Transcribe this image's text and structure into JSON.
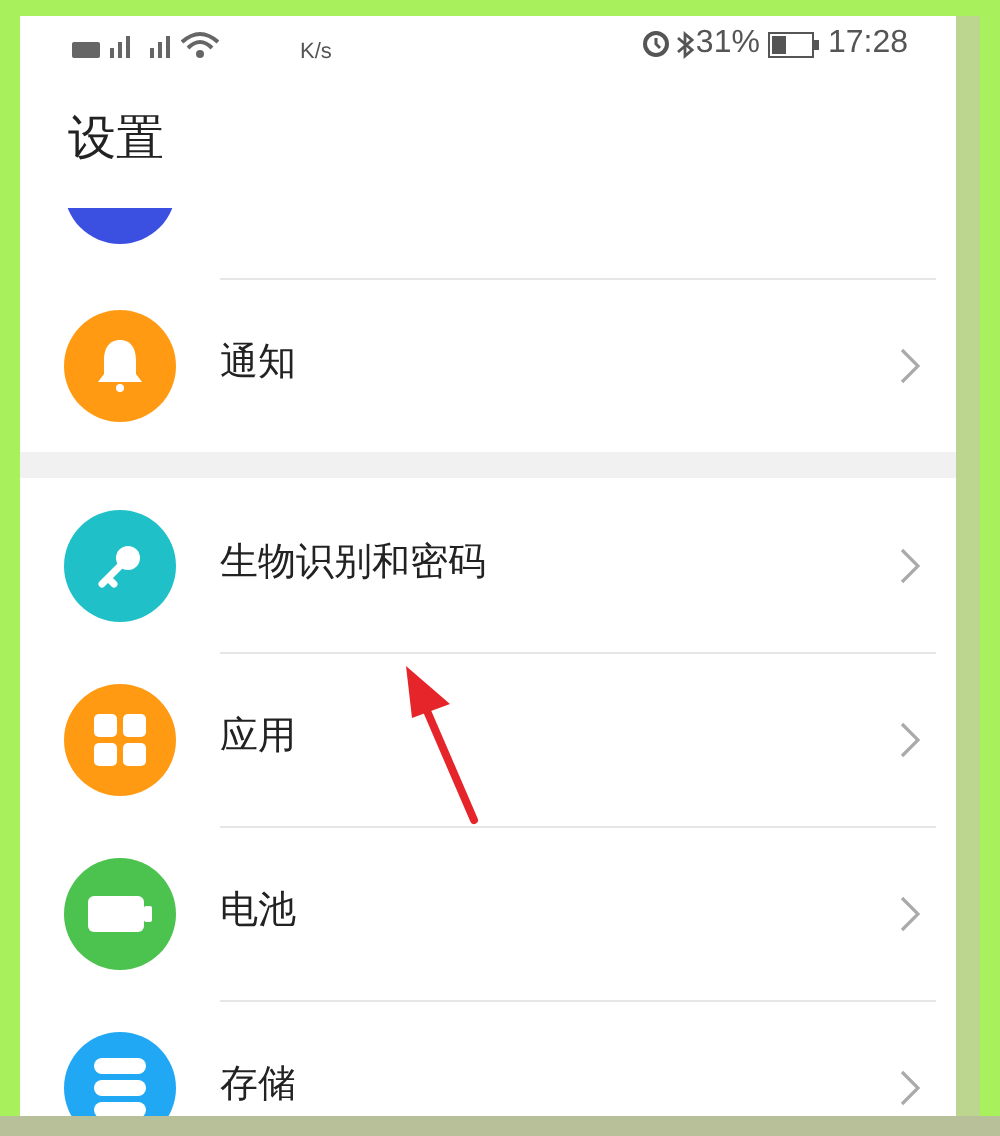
{
  "status_bar": {
    "speed_unit": "K/s",
    "battery": "31%",
    "time": "17:28"
  },
  "title": "设置",
  "groups": [
    {
      "items": [
        {
          "kind": "cut",
          "color": "#3b4fe0"
        },
        {
          "kind": "bell",
          "label": "通知",
          "color": "#ff9a12"
        }
      ]
    },
    {
      "items": [
        {
          "kind": "key",
          "label": "生物识别和密码",
          "color": "#1fc0c8"
        },
        {
          "kind": "apps",
          "label": "应用",
          "color": "#ff9a12"
        },
        {
          "kind": "battery",
          "label": "电池",
          "color": "#4cc24f"
        },
        {
          "kind": "storage",
          "label": "存储",
          "color": "#20a8f5"
        }
      ]
    }
  ]
}
